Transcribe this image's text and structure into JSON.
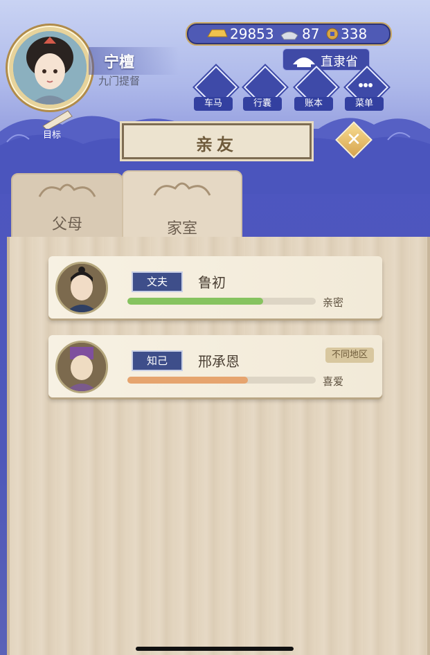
{
  "player": {
    "name": "宁檀",
    "title": "九门提督"
  },
  "currency": {
    "gold": "29853",
    "silver": "87",
    "coins": "338"
  },
  "location": {
    "name": "直隶省"
  },
  "nav": {
    "items": [
      {
        "label": "车马",
        "icon": "carriage-icon"
      },
      {
        "label": "行囊",
        "icon": "bag-icon"
      },
      {
        "label": "账本",
        "icon": "ledger-icon"
      },
      {
        "label": "菜单",
        "icon": "menu-dots-icon"
      }
    ],
    "goal_label": "目标"
  },
  "screen": {
    "title": "亲友"
  },
  "tabs": [
    {
      "label": "父母",
      "active": false
    },
    {
      "label": "家室",
      "active": true
    }
  ],
  "relations": [
    {
      "relation": "文夫",
      "name": "鲁初",
      "status": "亲密",
      "affinity": 0.72,
      "bar_color": "#86c35f",
      "region_tag": ""
    },
    {
      "relation": "知己",
      "name": "邢承恩",
      "status": "喜爱",
      "affinity": 0.64,
      "bar_color": "#e6a46e",
      "region_tag": "不同地区"
    }
  ],
  "colors": {
    "accent_purple": "#4d56c0",
    "panel": "#e4d6c0",
    "badge_blue": "#3e4e8a"
  }
}
